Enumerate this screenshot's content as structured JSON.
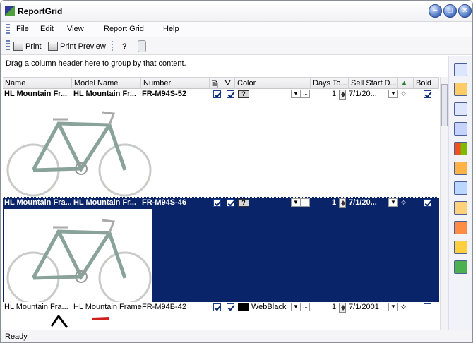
{
  "window": {
    "title": "ReportGrid"
  },
  "menubar": {
    "items": [
      "File",
      "Edit",
      "View",
      "Report Grid",
      "Help"
    ]
  },
  "toolbar": {
    "print": "Print",
    "print_preview": "Print Preview",
    "help_icon": "?"
  },
  "group_hint": "Drag a column header here to group by that content.",
  "columns": [
    "Name",
    "Model Name",
    "Number",
    "",
    "",
    "Color",
    "Days To...",
    "Sell Start D...",
    "",
    "Bold"
  ],
  "rows": [
    {
      "name": "HL Mountain Fr...",
      "model": "HL Mountain Fr...",
      "number": "FR-M94S-52",
      "color": "?",
      "days": "1",
      "sell_start": "7/1/20...",
      "bold": true,
      "selected": false
    },
    {
      "name": "HL Mountain Fra...",
      "model": "HL Mountain Fr...",
      "number": "FR-M94S-46",
      "color": "?",
      "days": "1",
      "sell_start": "7/1/20...",
      "bold": true,
      "selected": true
    },
    {
      "name": "HL Mountain Fra...",
      "model": "HL Mountain Frame",
      "number": "FR-M94B-42",
      "color": "WebBlack",
      "days": "1",
      "sell_start": "7/1/2001",
      "bold": false,
      "selected": false
    }
  ],
  "status": {
    "text": "Ready"
  },
  "colors": {
    "selection": "#0a246a",
    "accent": "#4f78c6"
  }
}
